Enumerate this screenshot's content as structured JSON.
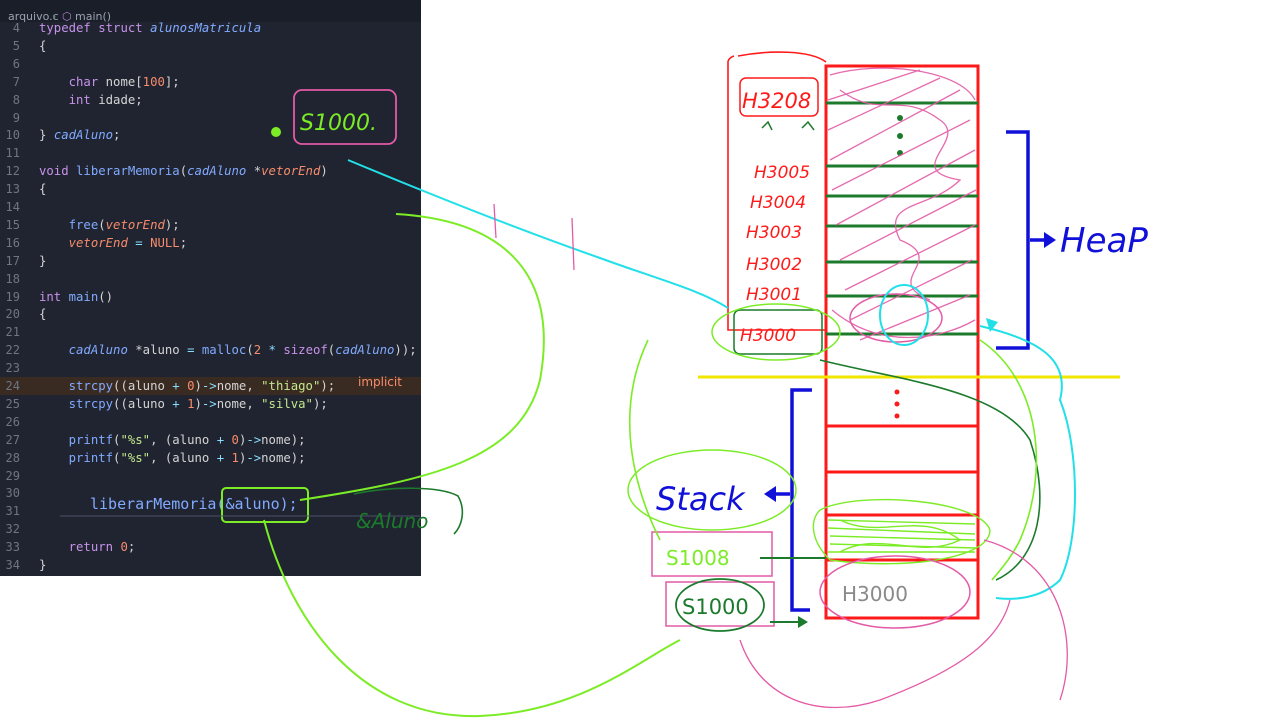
{
  "breadcrumb": {
    "file": "arquivo.c",
    "symbol": "main()"
  },
  "code_lines": [
    {
      "num": "4",
      "html": "<span class='kw'>typedef</span> <span class='kw'>struct</span> <span class='it'>alunosMatricula</span>"
    },
    {
      "num": "5",
      "html": "{"
    },
    {
      "num": "6",
      "html": ""
    },
    {
      "num": "7",
      "html": "    <span class='kw'>char</span> nome[<span class='nu'>100</span>];"
    },
    {
      "num": "8",
      "html": "    <span class='kw'>int</span> idade;"
    },
    {
      "num": "9",
      "html": ""
    },
    {
      "num": "10",
      "html": "} <span class='it'>cadAluno</span>;"
    },
    {
      "num": "11",
      "html": ""
    },
    {
      "num": "12",
      "html": "<span class='kw'>void</span> <span class='fn'>liberarMemoria</span>(<span class='it'>cadAluno</span> *<span class='pa'>vetorEnd</span>)"
    },
    {
      "num": "13",
      "html": "{"
    },
    {
      "num": "14",
      "html": ""
    },
    {
      "num": "15",
      "html": "    <span class='fn'>free</span>(<span class='pa'>vetorEnd</span>);"
    },
    {
      "num": "16",
      "html": "    <span class='pa'>vetorEnd</span> <span class='op'>=</span> <span class='nu'>NULL</span>;"
    },
    {
      "num": "17",
      "html": "}"
    },
    {
      "num": "18",
      "html": ""
    },
    {
      "num": "19",
      "html": "<span class='kw'>int</span> <span class='fn'>main</span>()"
    },
    {
      "num": "20",
      "html": "{"
    },
    {
      "num": "21",
      "html": ""
    },
    {
      "num": "22",
      "html": "    <span class='it'>cadAluno</span> *aluno <span class='op'>=</span> <span class='fn'>malloc</span>(<span class='nu'>2</span> <span class='op'>*</span> <span class='kw'>sizeof</span>(<span class='it'>cadAluno</span>));"
    },
    {
      "num": "23",
      "html": ""
    },
    {
      "num": "24",
      "html": "    <span class='fn'>strcpy</span>((aluno <span class='op'>+</span> <span class='nu'>0</span>)<span class='op'>-&gt;</span>nome, <span class='st'>\"thiago\"</span>);"
    },
    {
      "num": "25",
      "html": "    <span class='fn'>strcpy</span>((aluno <span class='op'>+</span> <span class='nu'>1</span>)<span class='op'>-&gt;</span>nome, <span class='st'>\"silva\"</span>);"
    },
    {
      "num": "26",
      "html": ""
    },
    {
      "num": "27",
      "html": "    <span class='fn'>printf</span>(<span class='st'>\"%s\"</span>, (aluno <span class='op'>+</span> <span class='nu'>0</span>)<span class='op'>-&gt;</span>nome);"
    },
    {
      "num": "28",
      "html": "    <span class='fn'>printf</span>(<span class='st'>\"%s\"</span>, (aluno <span class='op'>+</span> <span class='nu'>1</span>)<span class='op'>-&gt;</span>nome);"
    },
    {
      "num": "29",
      "html": ""
    },
    {
      "num": "30",
      "html": ""
    },
    {
      "num": "31",
      "html": ""
    },
    {
      "num": "32",
      "html": ""
    },
    {
      "num": "33",
      "html": "    <span class='kw'>return</span> <span class='nu'>0</span>;"
    },
    {
      "num": "34",
      "html": "}"
    }
  ],
  "zoomed_call": "liberarMemoria(&aluno);",
  "hint": "implicit",
  "annotations": {
    "heap": "HeaP",
    "stack": "Stack",
    "s1000": "S1000.",
    "stack_s1000": "S1000",
    "stack_s1008": "S1008",
    "aluno_hand": "&Aluno",
    "h_addresses": [
      "H3208",
      "H3005",
      "H3004",
      "H3003",
      "H3002",
      "H3001",
      "H3000"
    ]
  },
  "colors": {
    "editor_bg": "#1f2430",
    "red": "#ff1a1a",
    "green": "#7cec27",
    "dark_green": "#1b7a2b",
    "blue": "#1010d8",
    "cyan": "#22e0e8",
    "yellow": "#f2e600",
    "pink": "#e35aa6"
  }
}
